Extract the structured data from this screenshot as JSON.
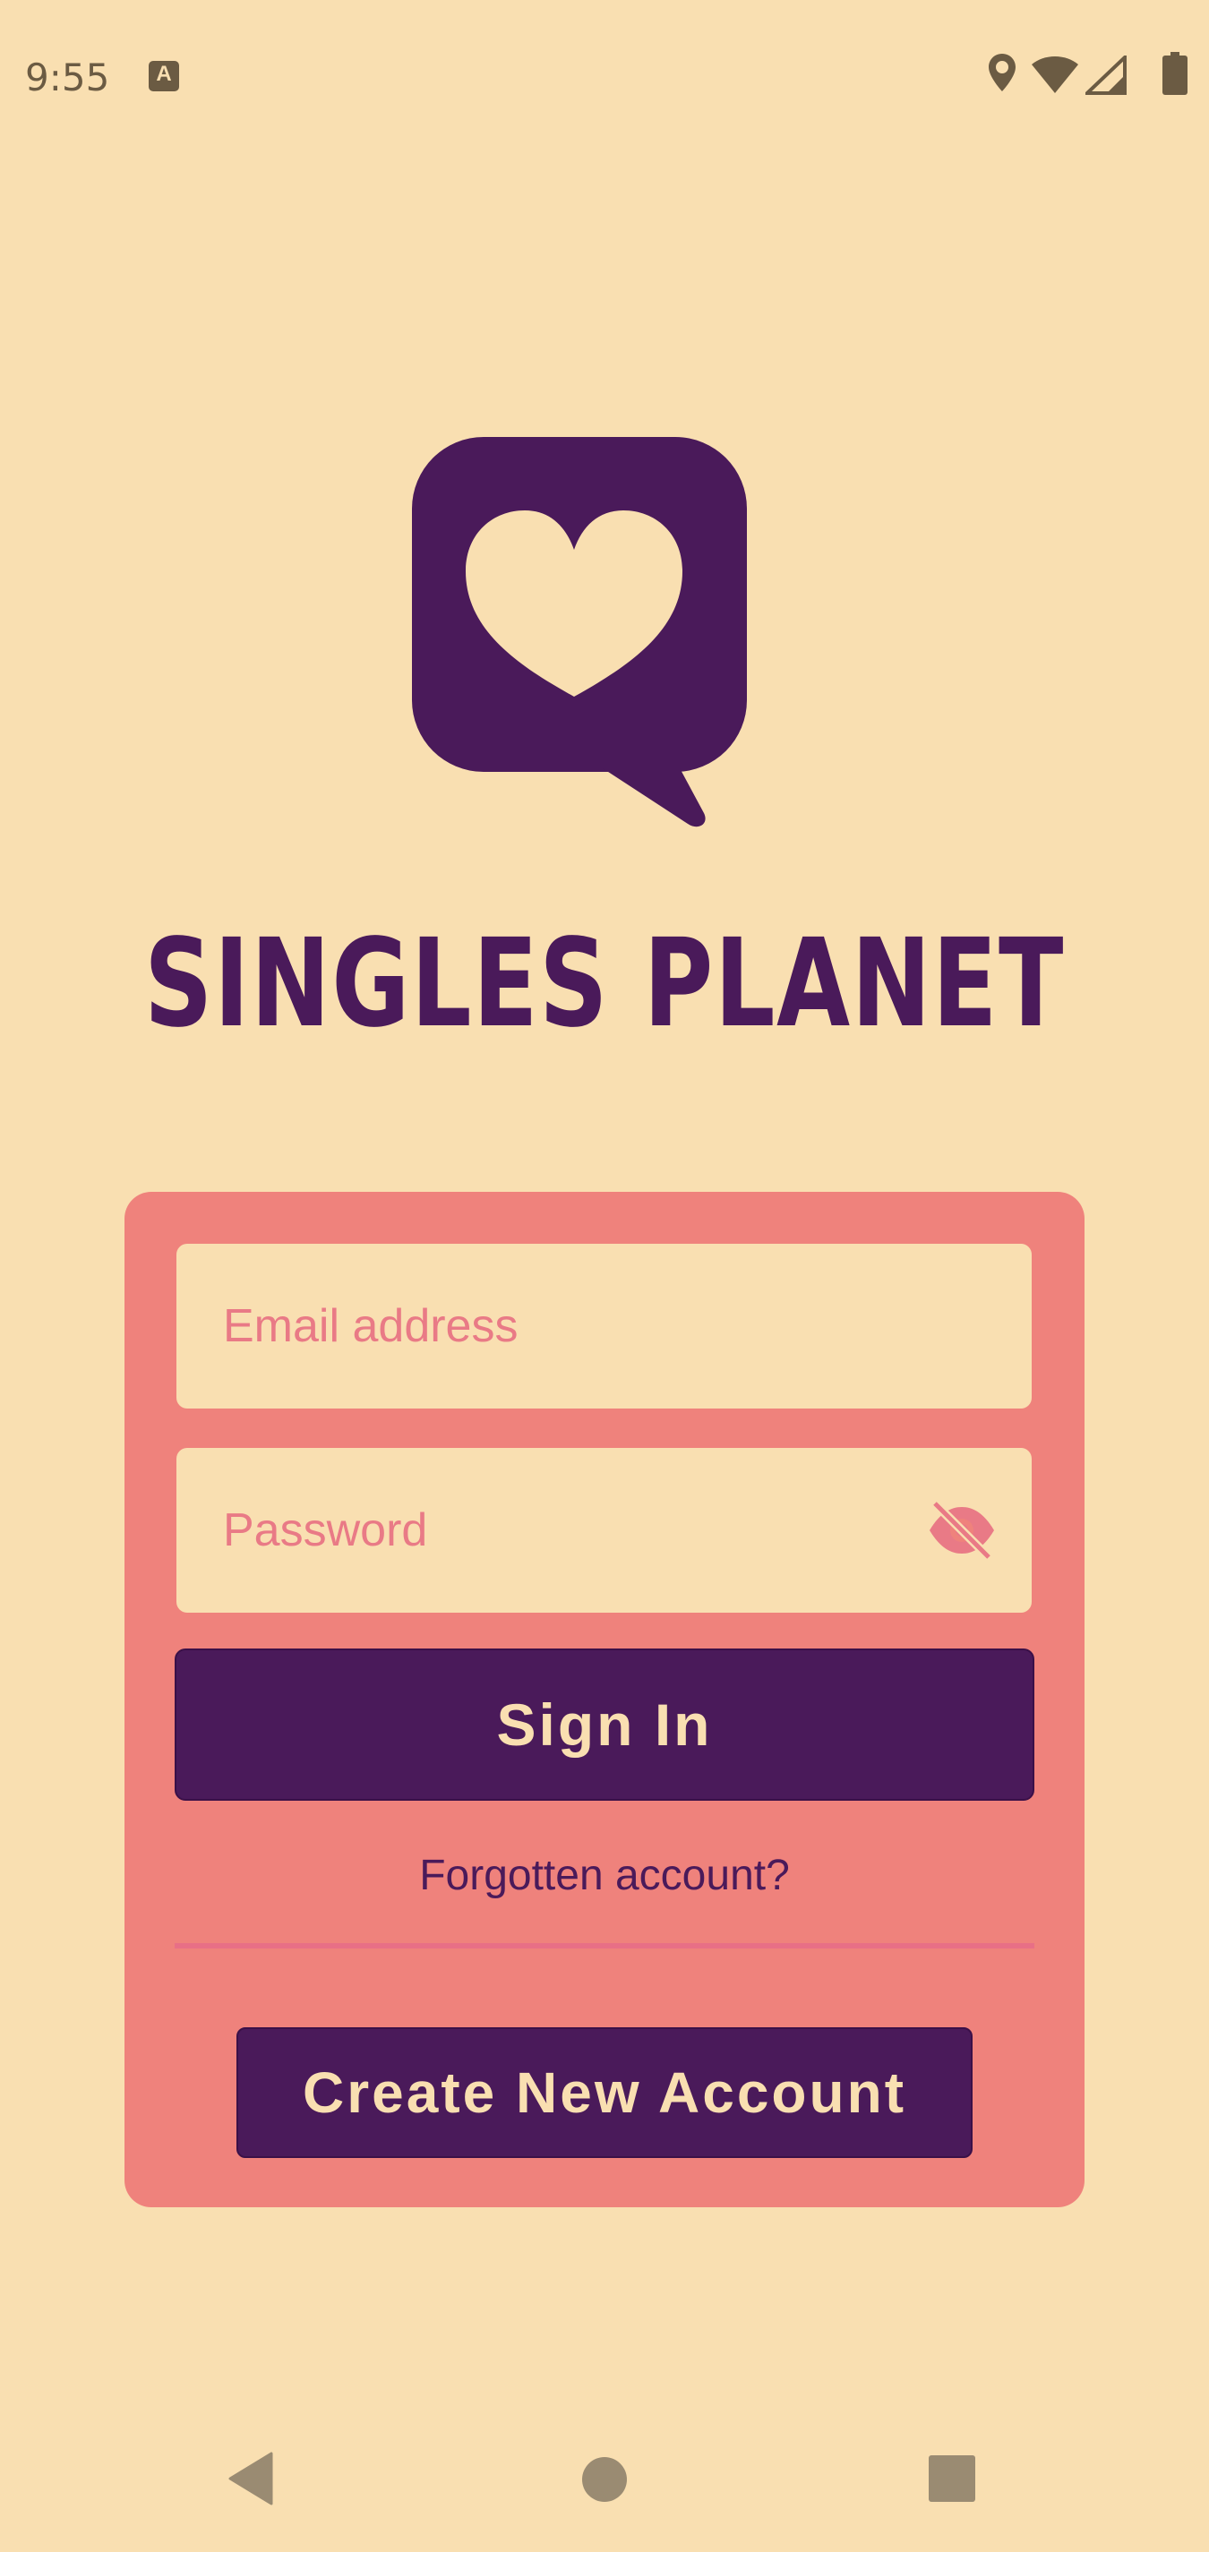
{
  "status_bar": {
    "time": "9:55",
    "notification_icon": "a-icon",
    "icons": [
      "location-icon",
      "wifi-icon",
      "cell-signal-icon",
      "battery-icon"
    ]
  },
  "app": {
    "name": "SINGLES PLANET",
    "logo_icon": "heart-chat-bubble-icon"
  },
  "login_form": {
    "email_placeholder": "Email address",
    "email_value": "",
    "password_placeholder": "Password",
    "password_value": "",
    "password_toggle_icon": "eye-off-icon",
    "sign_in_label": "Sign In",
    "forgot_label": "Forgotten account?",
    "create_account_label": "Create New Account"
  },
  "nav_bar": {
    "back_icon": "back-triangle-icon",
    "home_icon": "home-circle-icon",
    "recents_icon": "recents-square-icon"
  },
  "colors": {
    "background": "#f9dfb1",
    "card": "#ef827c",
    "brand": "#4a1a5a",
    "placeholder": "#e97a86"
  }
}
